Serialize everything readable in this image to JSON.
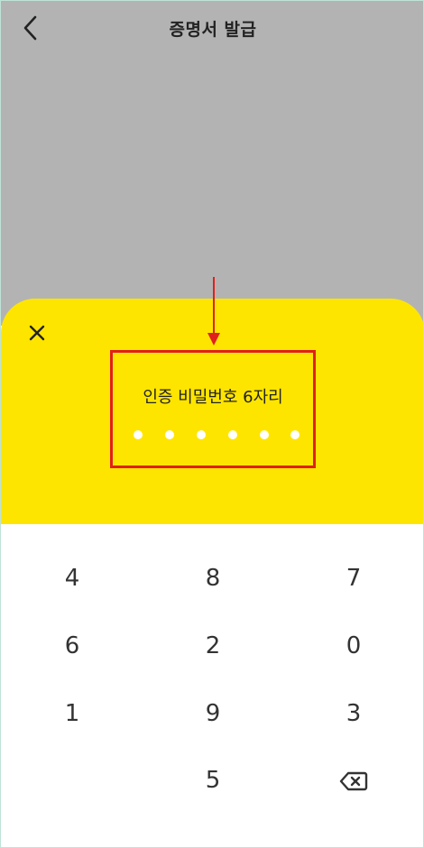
{
  "header": {
    "title": "증명서 발급",
    "back_icon": "chevron-left-icon"
  },
  "colors": {
    "dim_overlay": "#b3b3b3",
    "sheet": "#fee500",
    "highlight": "#e0201d",
    "pin_dot": "#ffffff"
  },
  "pin_sheet": {
    "close_icon": "close-icon",
    "label": "인증 비밀번호 6자리",
    "digits_total": 6,
    "digits_entered": 0
  },
  "keypad": {
    "rows": [
      [
        "4",
        "8",
        "7"
      ],
      [
        "6",
        "2",
        "0"
      ],
      [
        "1",
        "9",
        "3"
      ],
      [
        "",
        "5",
        "backspace-icon"
      ]
    ]
  }
}
